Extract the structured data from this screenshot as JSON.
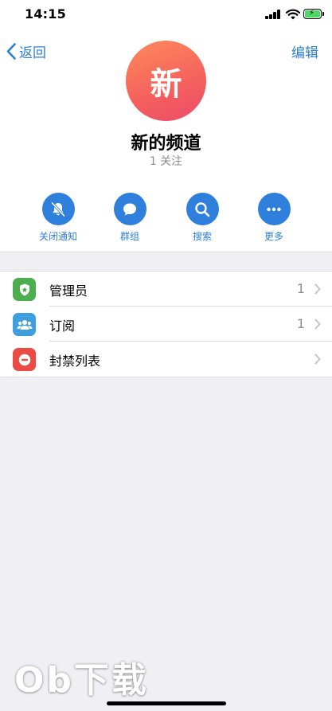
{
  "status_bar": {
    "time": "14:15"
  },
  "nav": {
    "back_label": "返回",
    "edit_label": "编辑"
  },
  "channel": {
    "avatar_char": "新",
    "name": "新的频道",
    "followers": "1 关注"
  },
  "actions": [
    {
      "label": "关闭通知",
      "icon": "bell-muted-icon"
    },
    {
      "label": "群组",
      "icon": "chat-bubble-icon"
    },
    {
      "label": "搜索",
      "icon": "search-icon"
    },
    {
      "label": "更多",
      "icon": "more-icon"
    }
  ],
  "list": [
    {
      "label": "管理员",
      "count": "1",
      "icon": "shield-star-icon",
      "color": "#4cae4f"
    },
    {
      "label": "订阅",
      "count": "1",
      "icon": "people-icon",
      "color": "#3e9ede"
    },
    {
      "label": "封禁列表",
      "count": "",
      "icon": "block-icon",
      "color": "#eb4b45"
    }
  ],
  "watermark": "Ob下载",
  "colors": {
    "accent": "#2d7fd3",
    "background": "#efeff4"
  }
}
